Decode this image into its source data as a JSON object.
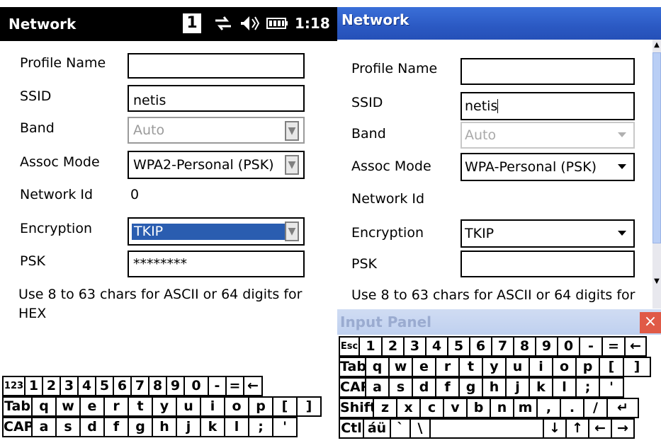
{
  "left": {
    "title": "Network",
    "status": {
      "sim": "1",
      "sync_icon": "sync-icon",
      "volume_icon": "volume-icon",
      "battery_icon": "battery-icon",
      "time": "1:18"
    },
    "form": {
      "profile_name": {
        "label": "Profile Name",
        "value": ""
      },
      "ssid": {
        "label": "SSID",
        "value": "netis"
      },
      "band": {
        "label": "Band",
        "value": "Auto"
      },
      "assoc_mode": {
        "label": "Assoc Mode",
        "value": "WPA2-Personal (PSK)"
      },
      "network_id": {
        "label": "Network Id",
        "value": "0"
      },
      "encryption": {
        "label": "Encryption",
        "value": "TKIP"
      },
      "psk": {
        "label": "PSK",
        "value": "********"
      }
    },
    "help_text": "Use 8 to 63 chars for ASCII or 64 digits for HEX",
    "keyboard": [
      [
        "123",
        "1",
        "2",
        "3",
        "4",
        "5",
        "6",
        "7",
        "8",
        "9",
        "0",
        "-",
        "=",
        "←"
      ],
      [
        "Tab",
        "q",
        "w",
        "e",
        "r",
        "t",
        "y",
        "u",
        "i",
        "o",
        "p",
        "[",
        "]"
      ],
      [
        "CAP",
        "a",
        "s",
        "d",
        "f",
        "g",
        "h",
        "j",
        "k",
        "l",
        ";",
        "'"
      ]
    ]
  },
  "right": {
    "title": "Network",
    "form": {
      "profile_name": {
        "label": "Profile Name",
        "value": ""
      },
      "ssid": {
        "label": "SSID",
        "value": "netis"
      },
      "band": {
        "label": "Band",
        "value": "Auto"
      },
      "assoc_mode": {
        "label": "Assoc Mode",
        "value": "WPA-Personal (PSK)"
      },
      "network_id": {
        "label": "Network Id",
        "value": ""
      },
      "encryption": {
        "label": "Encryption",
        "value": "TKIP"
      },
      "psk": {
        "label": "PSK",
        "value": ""
      }
    },
    "help_text": "Use 8 to 63 chars for ASCII or 64 digits for",
    "input_panel": {
      "label": "Input Panel",
      "close": "×"
    },
    "keyboard": [
      [
        "Esc",
        "1",
        "2",
        "3",
        "4",
        "5",
        "6",
        "7",
        "8",
        "9",
        "0",
        "-",
        "=",
        "←"
      ],
      [
        "Tab",
        "q",
        "w",
        "e",
        "r",
        "t",
        "y",
        "u",
        "i",
        "o",
        "p",
        "[",
        "]"
      ],
      [
        "CAP",
        "a",
        "s",
        "d",
        "f",
        "g",
        "h",
        "j",
        "k",
        "l",
        ";",
        "'"
      ],
      [
        "Shift",
        "z",
        "x",
        "c",
        "v",
        "b",
        "n",
        "m",
        ",",
        ".",
        "/",
        "↵"
      ],
      [
        "Ctl",
        "áü",
        "`",
        "\\",
        " ",
        "↓",
        "↑",
        "←",
        "→"
      ]
    ]
  }
}
